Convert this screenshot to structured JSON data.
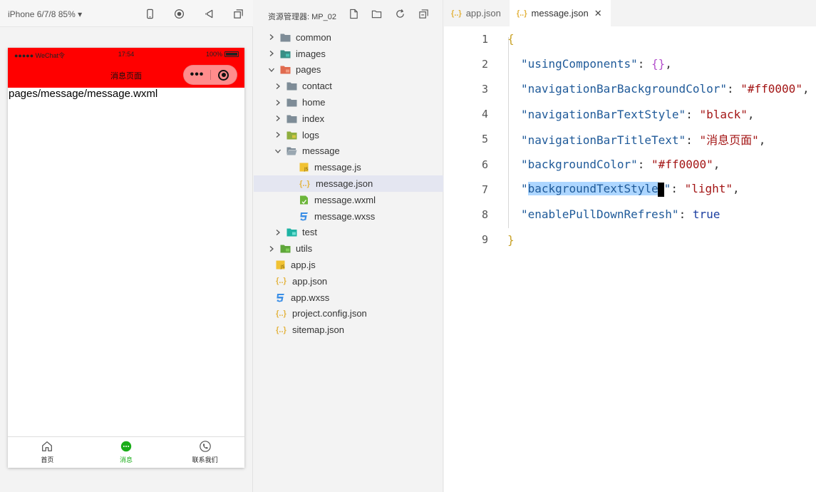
{
  "simulator": {
    "device": "iPhone 6/7/8 85% ▾",
    "status": {
      "signal": "●●●●● WeChat令",
      "time": "17:54",
      "battery": "100%"
    },
    "nav_title": "消息页面",
    "capsule_more": "•••",
    "page_text": "pages/message/message.wxml",
    "tabbar": [
      {
        "label": "首页",
        "icon": "home-icon"
      },
      {
        "label": "消息",
        "icon": "message-icon",
        "active": true
      },
      {
        "label": "联系我们",
        "icon": "phone-icon"
      }
    ],
    "colors": {
      "navbar": "#ff0000",
      "tab_active": "#1aad19"
    }
  },
  "explorer": {
    "title": "资源管理器: MP_02",
    "tree": [
      {
        "label": "common",
        "depth": 0,
        "chevron": "right",
        "icon": "folder"
      },
      {
        "label": "images",
        "depth": 0,
        "chevron": "right",
        "icon": "folder-images"
      },
      {
        "label": "pages",
        "depth": 0,
        "chevron": "down",
        "icon": "folder-pages"
      },
      {
        "label": "contact",
        "depth": 1,
        "chevron": "right",
        "icon": "folder"
      },
      {
        "label": "home",
        "depth": 1,
        "chevron": "right",
        "icon": "folder"
      },
      {
        "label": "index",
        "depth": 1,
        "chevron": "right",
        "icon": "folder"
      },
      {
        "label": "logs",
        "depth": 1,
        "chevron": "right",
        "icon": "folder-logs"
      },
      {
        "label": "message",
        "depth": 1,
        "chevron": "down",
        "icon": "folder-open"
      },
      {
        "label": "message.js",
        "depth": 2,
        "chevron": "none",
        "icon": "js"
      },
      {
        "label": "message.json",
        "depth": 2,
        "chevron": "none",
        "icon": "json",
        "selected": true
      },
      {
        "label": "message.wxml",
        "depth": 2,
        "chevron": "none",
        "icon": "wxml"
      },
      {
        "label": "message.wxss",
        "depth": 2,
        "chevron": "none",
        "icon": "css"
      },
      {
        "label": "test",
        "depth": 1,
        "chevron": "right",
        "icon": "folder-test"
      },
      {
        "label": "utils",
        "depth": 0,
        "chevron": "right",
        "icon": "folder-utils"
      },
      {
        "label": "app.js",
        "depth": 0,
        "chevron": "none",
        "icon": "js"
      },
      {
        "label": "app.json",
        "depth": 0,
        "chevron": "none",
        "icon": "json"
      },
      {
        "label": "app.wxss",
        "depth": 0,
        "chevron": "none",
        "icon": "css"
      },
      {
        "label": "project.config.json",
        "depth": 0,
        "chevron": "none",
        "icon": "json"
      },
      {
        "label": "sitemap.json",
        "depth": 0,
        "chevron": "none",
        "icon": "json"
      }
    ]
  },
  "editor": {
    "tabs": [
      {
        "label": "app.json",
        "active": false
      },
      {
        "label": "message.json",
        "active": true,
        "close": "✕"
      }
    ],
    "json_glyph": "{..}",
    "lines": [
      {
        "n": "1",
        "open": "{"
      },
      {
        "n": "2",
        "key": "\"usingComponents\"",
        "sep": ": ",
        "obj": "{}",
        "tail": ","
      },
      {
        "n": "3",
        "key": "\"navigationBarBackgroundColor\"",
        "sep": ": ",
        "val": "\"#ff0000\"",
        "tail": ","
      },
      {
        "n": "4",
        "key": "\"navigationBarTextStyle\"",
        "sep": ": ",
        "val": "\"black\"",
        "tail": ","
      },
      {
        "n": "5",
        "key": "\"navigationBarTitleText\"",
        "sep": ": ",
        "val": "\"消息页面\"",
        "tail": ","
      },
      {
        "n": "6",
        "key": "\"backgroundColor\"",
        "sep": ": ",
        "val": "\"#ff0000\"",
        "tail": ","
      },
      {
        "n": "7",
        "q1": "\"",
        "hl": "backgroundTextStyle",
        "q2": "\"",
        "sep": ": ",
        "val": "\"light\"",
        "tail": ","
      },
      {
        "n": "8",
        "key": "\"enablePullDownRefresh\"",
        "sep": ": ",
        "bool": "true"
      },
      {
        "n": "9",
        "close": "}"
      }
    ]
  }
}
